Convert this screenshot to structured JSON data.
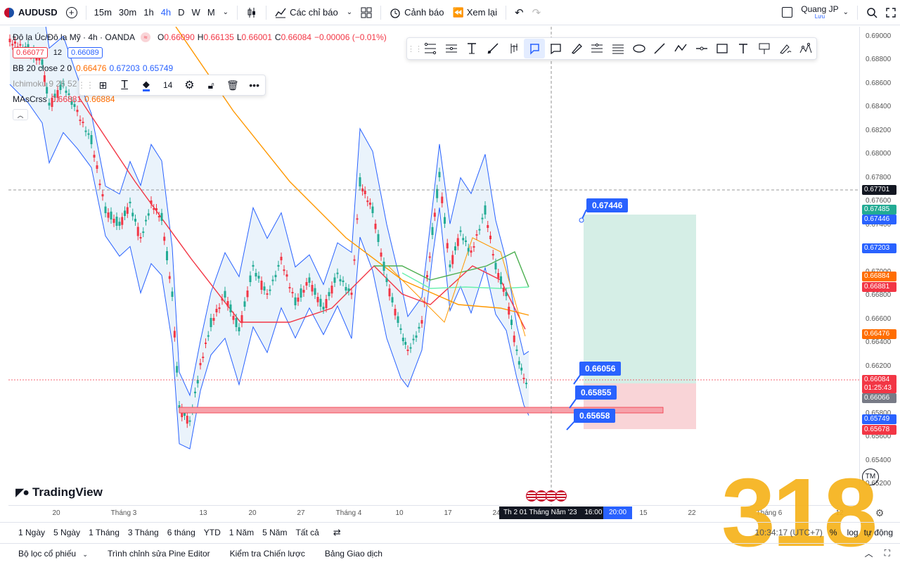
{
  "topbar": {
    "symbol": "AUDUSD",
    "timeframes": [
      "15m",
      "30m",
      "1h",
      "4h",
      "D",
      "W",
      "M"
    ],
    "active_timeframe": "4h",
    "indicators_label": "Các chỉ báo",
    "alerts_label": "Cảnh báo",
    "replay_label": "Xem lại",
    "user_name": "Quang JP",
    "user_sub": "Lưu"
  },
  "legend": {
    "title": "Đô la Úc/Đô la Mỹ · 4h · OANDA",
    "o_label": "O",
    "o": "0.66090",
    "h_label": "H",
    "h": "0.66135",
    "l_label": "L",
    "l": "0.66001",
    "c_label": "C",
    "c": "0.66084",
    "change": "−0.00006 (−0.01%)",
    "sell_price": "0.66077",
    "spread": "12",
    "buy_price": "0.66089",
    "bb_name": "BB 20 close 2 0",
    "bb_v1": "0.66476",
    "bb_v2": "0.67203",
    "bb_v3": "0.65749",
    "ichimoku_name": "Ichimoku 9 26 52",
    "mas_name": "MAsCrss",
    "mas_v1": "0.66881",
    "mas_v2": "0.66884"
  },
  "mini_toolbar": {
    "font_size": "14"
  },
  "price_axis": {
    "labels": [
      "0.69000",
      "0.68800",
      "0.68600",
      "0.68400",
      "0.68200",
      "0.68000",
      "0.67800",
      "0.67600",
      "0.67400",
      "0.67000",
      "0.66800",
      "0.66600",
      "0.66400",
      "0.66200",
      "0.65800",
      "0.65600",
      "0.65400",
      "0.65200"
    ],
    "tags": [
      {
        "text": "0.67701",
        "color": "#131722"
      },
      {
        "text": "0.67485",
        "color": "#22ab94"
      },
      {
        "text": "0.67446",
        "color": "#2962ff"
      },
      {
        "text": "0.67203",
        "color": "#2962ff"
      },
      {
        "text": "0.66884",
        "color": "#ff6d00"
      },
      {
        "text": "0.66881",
        "color": "#f23645"
      },
      {
        "text": "0.66476",
        "color": "#ff6d00"
      },
      {
        "text": "0.66084",
        "color": "#f23645"
      },
      {
        "text": "01:25:43",
        "color": "#f23645"
      },
      {
        "text": "0.66066",
        "color": "#787b86"
      },
      {
        "text": "0.65749",
        "color": "#2962ff"
      },
      {
        "text": "0.65678",
        "color": "#f23645"
      }
    ]
  },
  "time_axis": {
    "labels": [
      "20",
      "Tháng 3",
      "13",
      "20",
      "27",
      "Tháng 4",
      "10",
      "17",
      "24",
      "15",
      "22",
      "Tháng 6",
      "12"
    ],
    "crosshair": "Th 2 01 Tháng Năm '23",
    "crosshair_time": "16:00",
    "crosshair_time2": "20:00"
  },
  "callouts": {
    "target": "0.67446",
    "entry": "0.66056",
    "level": "0.65855",
    "stop": "0.65658"
  },
  "range_bar": {
    "ranges": [
      "1 Ngày",
      "5 Ngày",
      "1 Tháng",
      "3 Tháng",
      "6 tháng",
      "YTD",
      "1 Năm",
      "5 Năm",
      "Tất cả"
    ],
    "clock": "10:34:17 (UTC+7)",
    "percent": "%",
    "log": "log",
    "auto": "tự động"
  },
  "bottom_panel": {
    "tabs": [
      "Bộ lọc cổ phiếu",
      "Trình chỉnh sửa Pine Editor",
      "Kiểm tra Chiến lược",
      "Bảng Giao dịch"
    ]
  },
  "branding": {
    "logo": "TradingView",
    "watermark": "318",
    "tm": "TM"
  },
  "colors": {
    "accent": "#2962ff",
    "up": "#22ab94",
    "down": "#f23645",
    "bb_fill": "#eaf3fb",
    "tp_zone": "#d5eee6",
    "sl_zone": "#f9d4d7"
  }
}
